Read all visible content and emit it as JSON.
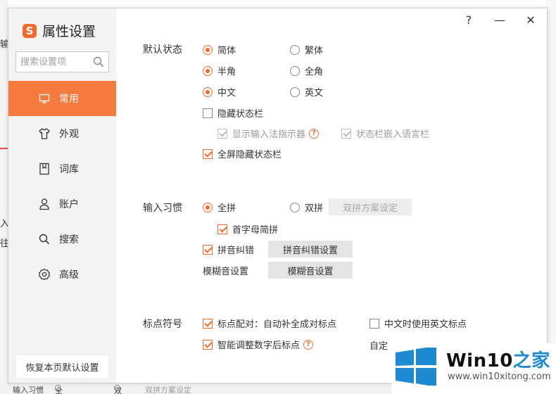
{
  "window": {
    "title": "属性设置",
    "logo_glyph": "S",
    "help": "?",
    "minimize": "—",
    "close": "✕"
  },
  "sidebar": {
    "search_placeholder": "搜索设置项",
    "items": [
      {
        "label": "常用",
        "icon": "monitor-icon"
      },
      {
        "label": "外观",
        "icon": "shirt-icon"
      },
      {
        "label": "词库",
        "icon": "book-icon"
      },
      {
        "label": "账户",
        "icon": "user-icon"
      },
      {
        "label": "搜索",
        "icon": "search-icon"
      },
      {
        "label": "高级",
        "icon": "gear-icon"
      }
    ],
    "reset_label": "恢复本页默认设置"
  },
  "default_state": {
    "label": "默认状态",
    "simplified": "简体",
    "traditional": "繁体",
    "half_width": "半角",
    "full_width": "全角",
    "chinese": "中文",
    "english": "英文",
    "hide_statusbar": "隐藏状态栏",
    "show_indicator": "显示输入法指示器",
    "embed_langbar": "状态栏嵌入语言栏",
    "fullscreen_hide": "全屏隐藏状态栏"
  },
  "input_habit": {
    "label": "输入习惯",
    "quanpin": "全拼",
    "shuangpin": "双拼",
    "shuangpin_settings": "双拼方案设定",
    "initial_abbrev": "首字母简拼",
    "pinyin_correction": "拼音纠错",
    "pinyin_correction_settings": "拼音纠错设置",
    "fuzzy_label": "模糊音设置",
    "fuzzy_button": "模糊音设置"
  },
  "punctuation": {
    "label": "标点符号",
    "auto_pair": "标点配对：自动补全成对标点",
    "english_punct": "中文时使用英文标点",
    "smart_adjust": "智能调整数字后标点",
    "custom_truncated": "自定"
  },
  "background": {
    "frag1": "输",
    "frag2": "入",
    "frag3": "往",
    "bottom_label": "输入习惯",
    "bottom_quanpin": "全拼",
    "bottom_shuangpin": "双拼",
    "bottom_btn": "双拼方案设定"
  },
  "watermark": {
    "title_a": "Win10",
    "title_b": "之家",
    "url": "www.win10xitong.com"
  },
  "colors": {
    "accent": "#f47a3d",
    "checked": "#f06b2b",
    "sidebar_bg": "#f3f3f3"
  }
}
